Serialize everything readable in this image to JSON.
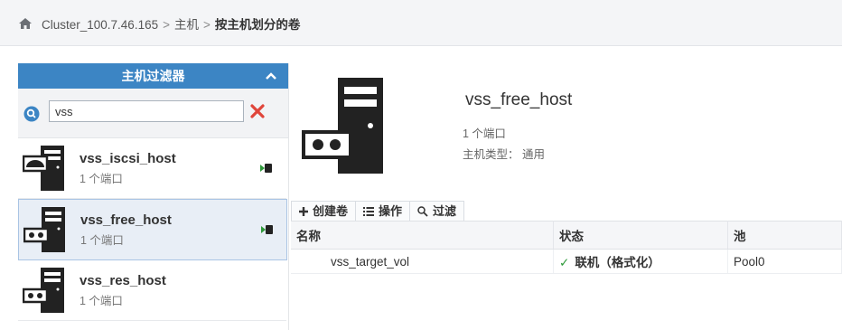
{
  "breadcrumb": {
    "cluster": "Cluster_100.7.46.165",
    "sep": ">",
    "host": "主机",
    "current": "按主机划分的卷"
  },
  "filter": {
    "title": "主机过滤器",
    "search_value": "vss",
    "hosts": [
      {
        "name": "vss_iscsi_host",
        "ports": "1 个端口",
        "icon": "server-with-disk-icon"
      },
      {
        "name": "vss_free_host",
        "ports": "1 个端口",
        "icon": "server-with-ports-icon"
      },
      {
        "name": "vss_res_host",
        "ports": "1 个端口",
        "icon": "server-with-ports-icon"
      }
    ]
  },
  "detail": {
    "name": "vss_free_host",
    "ports": "1 个端口",
    "host_type": "主机类型： 通用"
  },
  "toolbar": {
    "create": "创建卷",
    "actions": "操作",
    "filter": "过滤"
  },
  "table": {
    "headers": [
      "名称",
      "状态",
      "池"
    ],
    "rows": [
      {
        "name": "vss_target_vol",
        "status": "联机（格式化）",
        "pool": "Pool0"
      }
    ]
  },
  "colors": {
    "header_blue": "#3c85c4",
    "selected_bg": "#e8eef6",
    "online_green": "#2e9a3a",
    "close_red": "#e0453a"
  }
}
